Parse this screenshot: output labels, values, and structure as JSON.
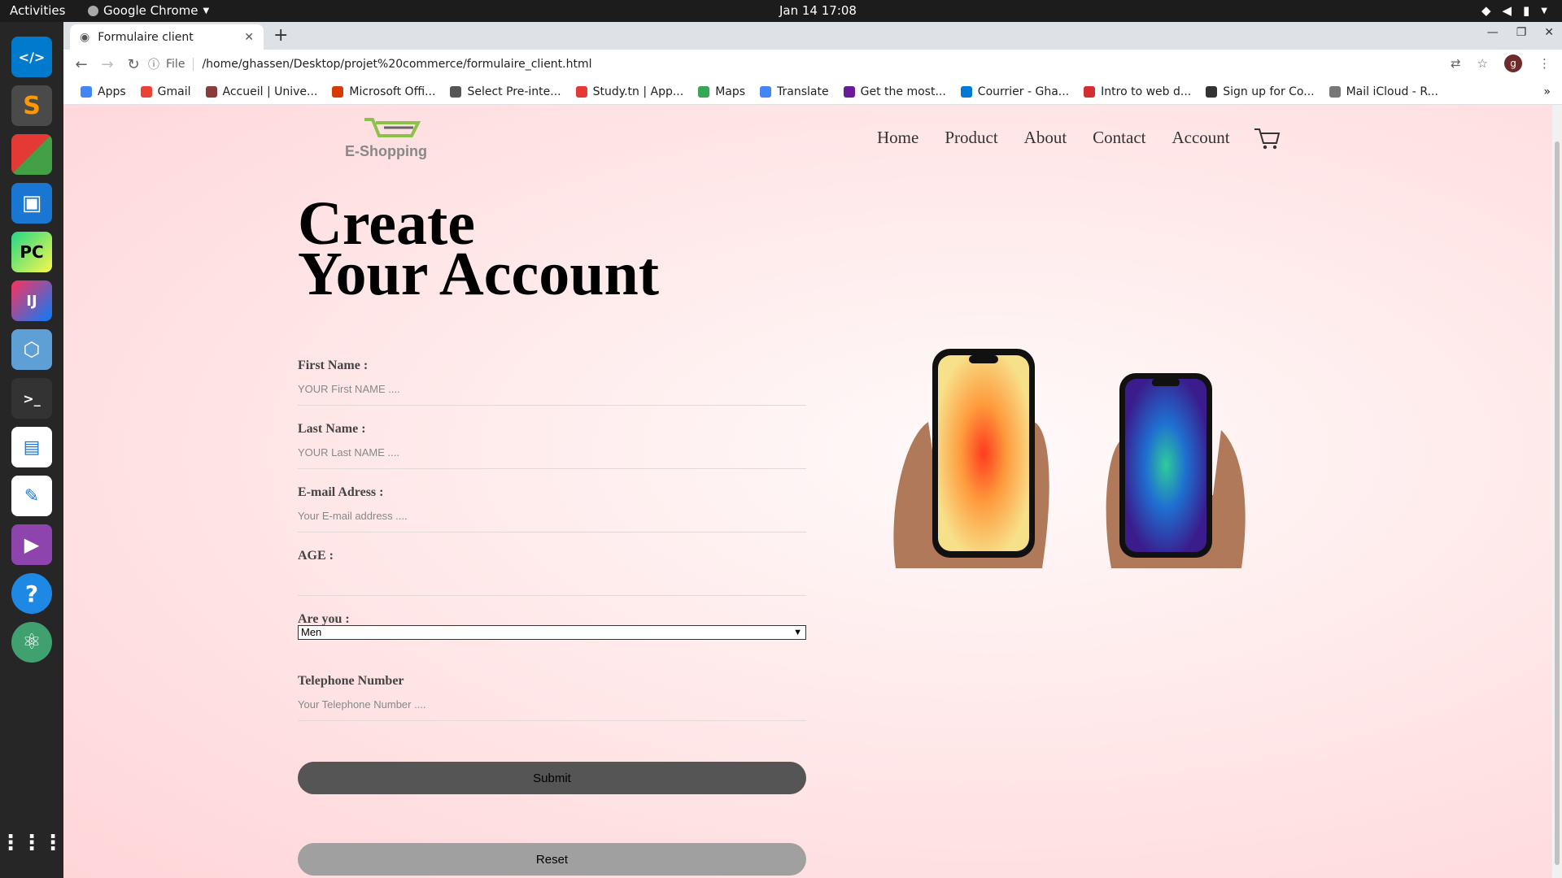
{
  "topbar": {
    "activities": "Activities",
    "app_name": "Google Chrome",
    "clock": "Jan 14  17:08"
  },
  "browser": {
    "tab_title": "Formulaire client",
    "url_scheme": "File",
    "url": "/home/ghassen/Desktop/projet%20commerce/formulaire_client.html",
    "profile_initial": "g",
    "bookmarks": [
      {
        "label": "Apps",
        "color": "#4285f4"
      },
      {
        "label": "Gmail",
        "color": "#ea4335"
      },
      {
        "label": "Accueil | Unive...",
        "color": "#8a3b3b"
      },
      {
        "label": "Microsoft Offi...",
        "color": "#d83b01"
      },
      {
        "label": "Select Pre-inte...",
        "color": "#555555"
      },
      {
        "label": "Study.tn | App...",
        "color": "#e53935"
      },
      {
        "label": "Maps",
        "color": "#34a853"
      },
      {
        "label": "Translate",
        "color": "#4285f4"
      },
      {
        "label": "Get the most...",
        "color": "#6a1b9a"
      },
      {
        "label": "Courrier - Gha...",
        "color": "#0078d4"
      },
      {
        "label": "Intro to web d...",
        "color": "#d32f2f"
      },
      {
        "label": "Sign up for Co...",
        "color": "#333333"
      },
      {
        "label": "Mail iCloud - R...",
        "color": "#777777"
      }
    ]
  },
  "site": {
    "logo_text": "E-Shopping",
    "nav": [
      "Home",
      "Product",
      "About",
      "Contact",
      "Account"
    ],
    "title_line1": "Create",
    "title_line2": "Your Account",
    "fields": {
      "first_name": {
        "label": "First Name :",
        "placeholder": "YOUR First NAME ...."
      },
      "last_name": {
        "label": "Last Name :",
        "placeholder": "YOUR Last NAME ...."
      },
      "email": {
        "label": "E-mail Adress :",
        "placeholder": "Your E-mail address ...."
      },
      "age": {
        "label": "AGE :",
        "placeholder": ""
      },
      "gender": {
        "label": "Are you :",
        "selected": "Men"
      },
      "telephone": {
        "label": "Telephone Number",
        "placeholder": "Your Telephone Number ...."
      }
    },
    "submit_label": "Submit",
    "reset_label": "Reset",
    "colors": {
      "submit": "#555555",
      "reset": "#a0a0a0",
      "logo_green": "#8bc34a"
    }
  }
}
